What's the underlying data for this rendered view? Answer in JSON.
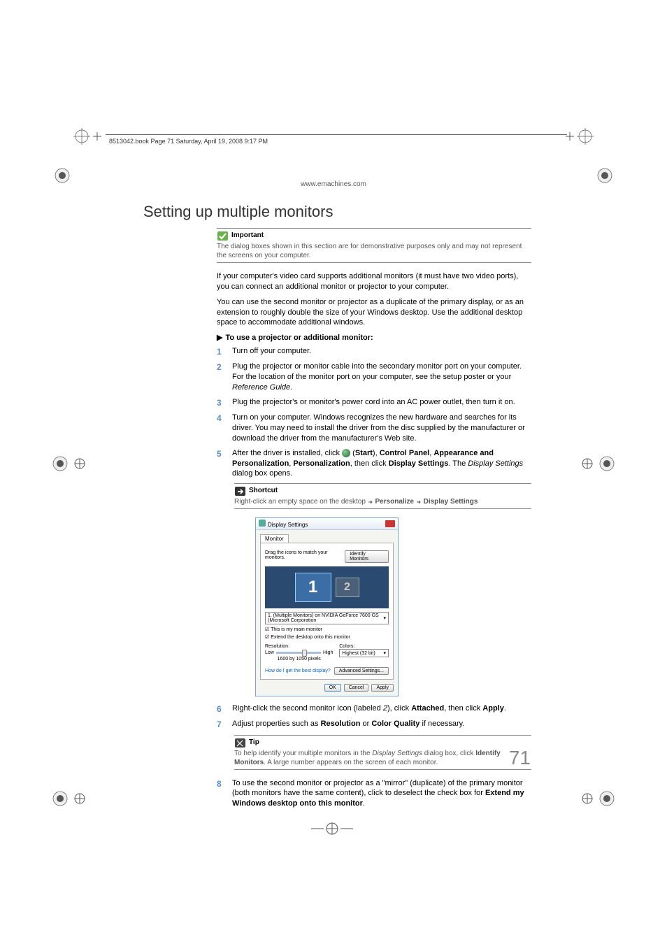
{
  "header": {
    "running": "8513042.book  Page 71  Saturday, April 19, 2008  9:17 PM",
    "url": "www.emachines.com"
  },
  "title": "Setting up multiple monitors",
  "important": {
    "label": "Important",
    "text": "The dialog boxes shown in this section are for demonstrative purposes only and may not represent the screens on your computer."
  },
  "para1": "If your computer's video card supports additional monitors (it must have two video ports), you can connect an additional monitor or projector to your computer.",
  "para2": "You can use the second monitor or projector as a duplicate of the primary display, or as an extension to roughly double the size of your Windows desktop. Use the additional desktop space to accommodate additional windows.",
  "proc_title": "To use a projector or additional monitor:",
  "steps": {
    "s1": "Turn off your computer.",
    "s2a": "Plug the projector or monitor cable into the secondary monitor port on your computer. For the location of the monitor port on your computer, see the setup poster or your ",
    "s2b": "Reference Guide",
    "s2c": ".",
    "s3": "Plug the projector's or monitor's power cord into an AC power outlet, then turn it on.",
    "s4": "Turn on your computer. Windows recognizes the new hardware and searches for its driver. You may need to install the driver from the disc supplied by the manufacturer or download the driver from the manufacturer's Web site.",
    "s5a": "After the driver is installed, click ",
    "s5b": " (",
    "s5c": "Start",
    "s5d": "), ",
    "s5e": "Control Panel",
    "s5f": ", ",
    "s5g": "Appearance and Personalization",
    "s5h": ", ",
    "s5i": "Personalization",
    "s5j": ", then click ",
    "s5k": "Display Settings",
    "s5l": ". The ",
    "s5m": "Display Settings",
    "s5n": " dialog box opens.",
    "s6a": "Right-click the second monitor icon (labeled ",
    "s6b": "2",
    "s6c": "), click ",
    "s6d": "Attached",
    "s6e": ", then click ",
    "s6f": "Apply",
    "s6g": ".",
    "s7a": "Adjust properties such as ",
    "s7b": "Resolution",
    "s7c": " or ",
    "s7d": "Color Quality",
    "s7e": " if necessary.",
    "s8a": "To use the second monitor or projector as a \"mirror\" (duplicate) of the primary monitor (both monitors have the same content), click to deselect the check box for ",
    "s8b": "Extend my Windows desktop onto this monitor",
    "s8c": "."
  },
  "shortcut": {
    "label": "Shortcut",
    "t1": "Right-click an empty space on the desktop ",
    "t2": "Personalize",
    "t3": "Display Settings"
  },
  "tip": {
    "label": "Tip",
    "t1": "To help identify your multiple monitors in the ",
    "t2": "Display Settings",
    "t3": " dialog box, click ",
    "t4": "Identify Monitors",
    "t5": ". A large number appears on the screen of each monitor."
  },
  "dialog": {
    "title": "Display Settings",
    "tab": "Monitor",
    "drag": "Drag the icons to match your monitors.",
    "identify": "Identify Monitors",
    "m1": "1",
    "m2": "2",
    "device": "1. (Multiple Monitors) on NVIDIA GeForce 7600 GS (Microsoft Corporation",
    "cb1": "This is my main monitor",
    "cb2": "Extend the desktop onto this monitor",
    "res_label": "Resolution:",
    "col_label": "Colors:",
    "low": "Low",
    "high": "High",
    "res_val": "1600 by 1050 pixels",
    "colors": "Highest (32 bit)",
    "help": "How do I get the best display?",
    "adv": "Advanced Settings...",
    "ok": "OK",
    "cancel": "Cancel",
    "apply": "Apply"
  },
  "page_number": "71"
}
